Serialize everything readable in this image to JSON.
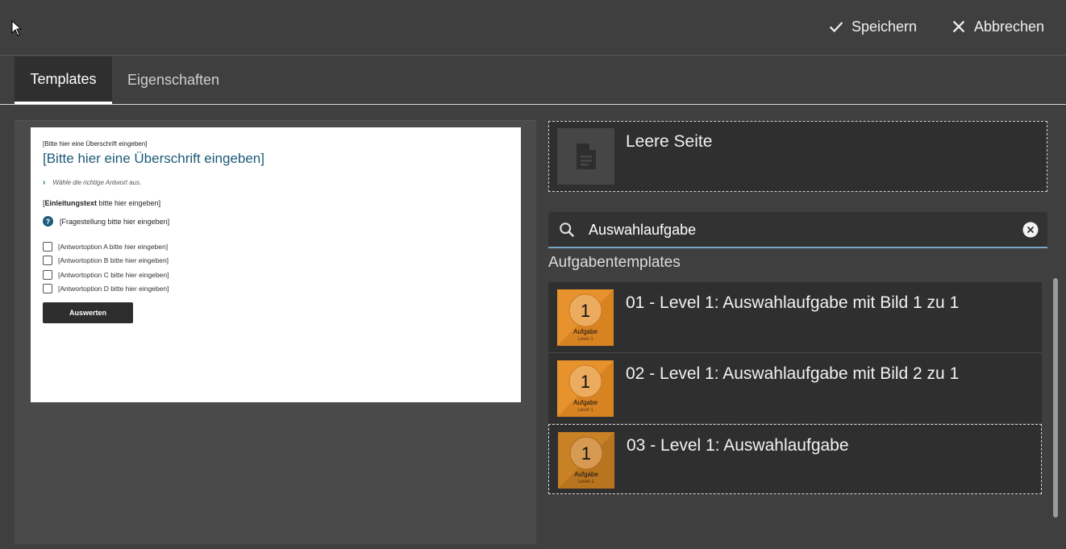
{
  "toolbar": {
    "save_label": "Speichern",
    "cancel_label": "Abbrechen"
  },
  "tabs": [
    {
      "label": "Templates",
      "active": true
    },
    {
      "label": "Eigenschaften",
      "active": false
    }
  ],
  "preview": {
    "small_heading": "[Bitte hier eine Überschrift eingeben]",
    "title": "[Bitte hier eine Überschrift eingeben]",
    "hint": "Wähle die richtige Antwort aus.",
    "intro_bold": "Einleitungstext",
    "intro_rest": " bitte hier eingeben]",
    "intro_open": "[",
    "question": "[Fragestellung bitte hier eingeben]",
    "options": [
      "[Antwortoption A bitte hier eingeben]",
      "[Antwortoption B bitte hier eingeben]",
      "[Antwortoption C bitte hier eingeben]",
      "[Antwortoption D bitte hier eingeben]"
    ],
    "button_label": "Auswerten"
  },
  "blank_page": {
    "label": "Leere Seite"
  },
  "search": {
    "value": "Auswahlaufgabe"
  },
  "section_title": "Aufgabentemplates",
  "results": [
    {
      "label": "01 - Level 1: Auswahlaufgabe mit Bild 1 zu 1",
      "badge_number": "1",
      "badge_title": "Aufgabe",
      "badge_sub": "Level 1"
    },
    {
      "label": "02 - Level 1: Auswahlaufgabe mit Bild 2 zu 1",
      "badge_number": "1",
      "badge_title": "Aufgabe",
      "badge_sub": "Level 1"
    },
    {
      "label": "03 - Level 1: Auswahlaufgabe",
      "badge_number": "1",
      "badge_title": "Aufgabe",
      "badge_sub": "Level 1"
    }
  ],
  "colors": {
    "accent": "#7aa6c8",
    "thumb_orange": "#e8922e",
    "title_blue": "#1d5a78"
  }
}
